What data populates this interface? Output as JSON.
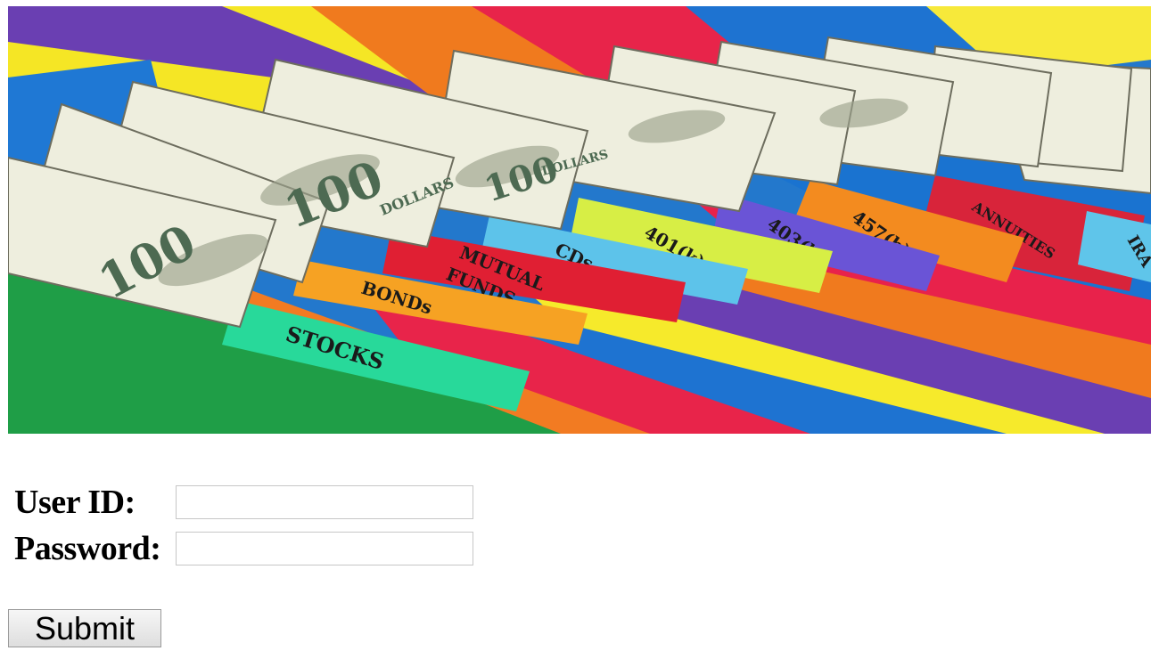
{
  "banner": {
    "folder_tabs": [
      "STOCKS",
      "BONDs",
      "MUTUAL",
      "FUNDS",
      "CDs",
      "401(k)",
      "403(b)",
      "457(b)",
      "ANNUITIES",
      "IRA"
    ],
    "bill_denomination": "100",
    "bill_word": "DOLLARS"
  },
  "form": {
    "user_id_label": "User ID:",
    "user_id_value": "",
    "password_label": "Password:",
    "password_value": "",
    "submit_label": "Submit"
  }
}
